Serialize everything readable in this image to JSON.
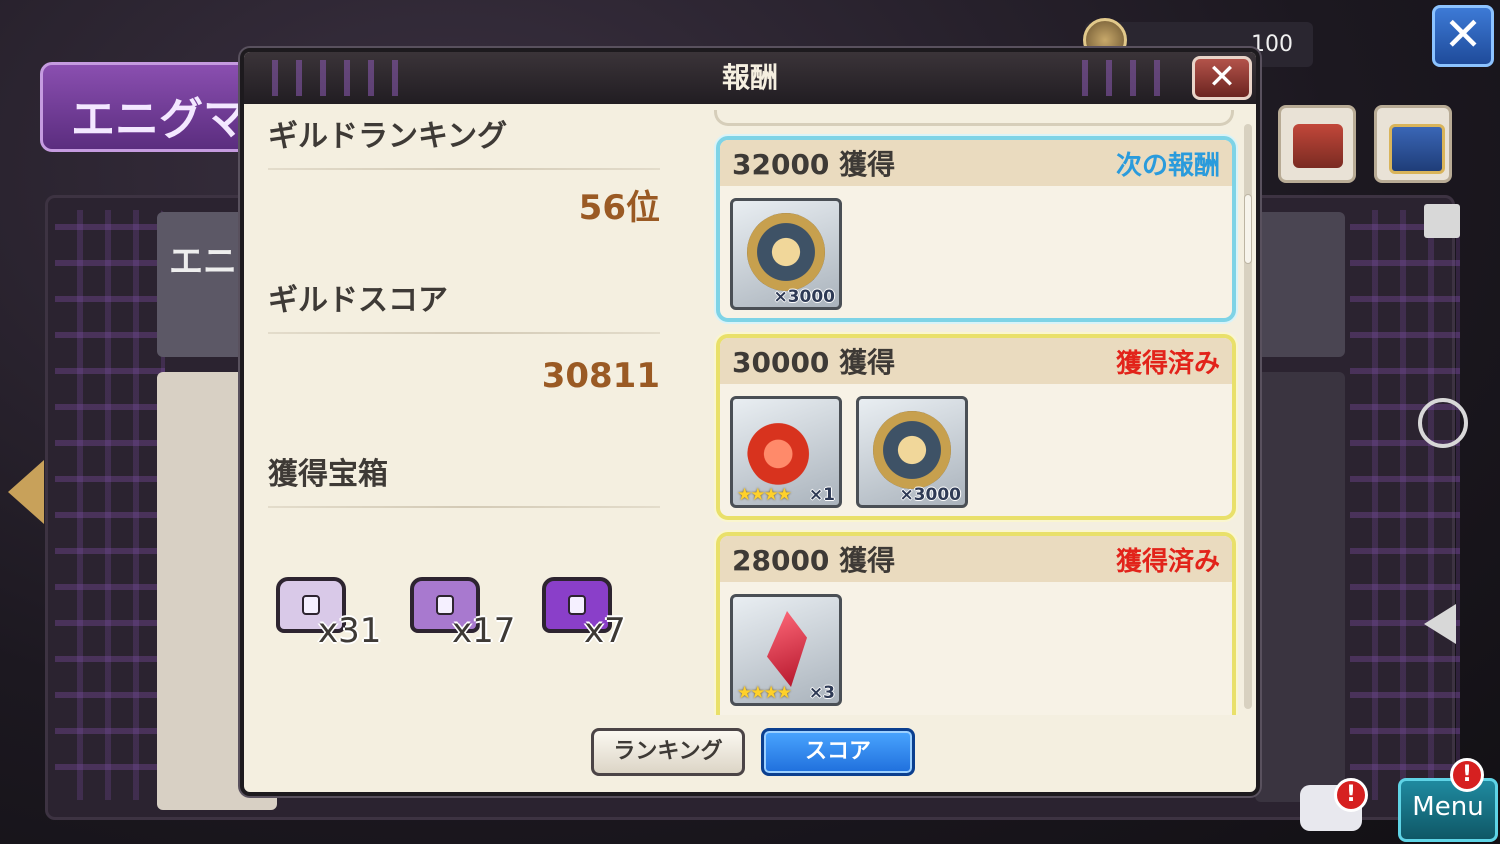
{
  "background": {
    "title_ribbon": "エニグマ",
    "card_title": "エニグマ",
    "top_counter": "100",
    "menu_label": "Menu"
  },
  "modal": {
    "title": "報酬",
    "close_glyph": "✕",
    "guild_ranking_label": "ギルドランキング",
    "guild_ranking_value": "56位",
    "guild_score_label": "ギルドスコア",
    "guild_score_value": "30811",
    "obtained_chests_label": "獲得宝箱",
    "chests": [
      {
        "count": "x31",
        "color": "#d9c9e8"
      },
      {
        "count": "x17",
        "color": "#a879cf"
      },
      {
        "count": "x7",
        "color": "#8a3fc9"
      }
    ],
    "rewards": [
      {
        "score": "32000 獲得",
        "status": "次の報酬",
        "state": "next",
        "items": [
          {
            "type": "medal",
            "qty": "×3000",
            "stars": ""
          }
        ]
      },
      {
        "score": "30000 獲得",
        "status": "獲得済み",
        "state": "done",
        "items": [
          {
            "type": "potion",
            "qty": "×1",
            "stars": "★★★★"
          },
          {
            "type": "medal",
            "qty": "×3000",
            "stars": ""
          }
        ]
      },
      {
        "score": "28000 獲得",
        "status": "獲得済み",
        "state": "done",
        "items": [
          {
            "type": "crystal",
            "qty": "×3",
            "stars": "★★★★"
          }
        ]
      }
    ],
    "tabs": {
      "ranking": "ランキング",
      "score": "スコア"
    }
  },
  "colors": {
    "accent_blue": "#2a9bdc",
    "obtained_red": "#e2231a",
    "value_brown": "#9a5a24"
  }
}
